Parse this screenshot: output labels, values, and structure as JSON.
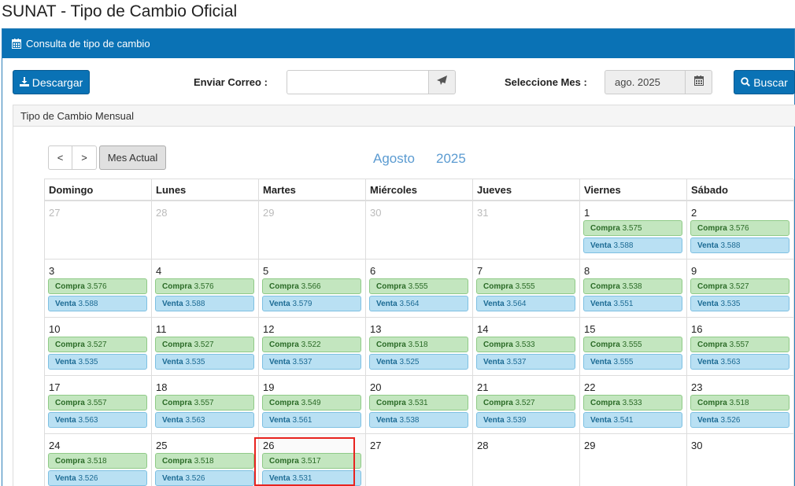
{
  "page": {
    "title": "SUNAT - Tipo de Cambio Oficial"
  },
  "panel": {
    "title": "Consulta de tipo de cambio",
    "icon": "calendar-icon"
  },
  "toolbar": {
    "download_label": "Descargar",
    "email_label": "Enviar Correo :",
    "email_value": "",
    "month_label": "Seleccione Mes :",
    "month_value": "ago. 2025",
    "search_label": "Buscar"
  },
  "calendar": {
    "section_title": "Tipo de Cambio Mensual",
    "prev_label": "<",
    "next_label": ">",
    "current_label": "Mes Actual",
    "month": "Agosto",
    "year": "2025",
    "weekdays": [
      "Domingo",
      "Lunes",
      "Martes",
      "Miércoles",
      "Jueves",
      "Viernes",
      "Sábado"
    ],
    "buy_prefix": "Compra",
    "sell_prefix": "Venta",
    "weeks": [
      [
        {
          "day": "27",
          "other": true
        },
        {
          "day": "28",
          "other": true
        },
        {
          "day": "29",
          "other": true
        },
        {
          "day": "30",
          "other": true
        },
        {
          "day": "31",
          "other": true
        },
        {
          "day": "1",
          "buy": "3.575",
          "sell": "3.588"
        },
        {
          "day": "2",
          "buy": "3.576",
          "sell": "3.588"
        }
      ],
      [
        {
          "day": "3",
          "buy": "3.576",
          "sell": "3.588"
        },
        {
          "day": "4",
          "buy": "3.576",
          "sell": "3.588"
        },
        {
          "day": "5",
          "buy": "3.566",
          "sell": "3.579"
        },
        {
          "day": "6",
          "buy": "3.555",
          "sell": "3.564"
        },
        {
          "day": "7",
          "buy": "3.555",
          "sell": "3.564"
        },
        {
          "day": "8",
          "buy": "3.538",
          "sell": "3.551"
        },
        {
          "day": "9",
          "buy": "3.527",
          "sell": "3.535"
        }
      ],
      [
        {
          "day": "10",
          "buy": "3.527",
          "sell": "3.535"
        },
        {
          "day": "11",
          "buy": "3.527",
          "sell": "3.535"
        },
        {
          "day": "12",
          "buy": "3.522",
          "sell": "3.537"
        },
        {
          "day": "13",
          "buy": "3.518",
          "sell": "3.525"
        },
        {
          "day": "14",
          "buy": "3.533",
          "sell": "3.537"
        },
        {
          "day": "15",
          "buy": "3.555",
          "sell": "3.555"
        },
        {
          "day": "16",
          "buy": "3.557",
          "sell": "3.563"
        }
      ],
      [
        {
          "day": "17",
          "buy": "3.557",
          "sell": "3.563"
        },
        {
          "day": "18",
          "buy": "3.557",
          "sell": "3.563"
        },
        {
          "day": "19",
          "buy": "3.549",
          "sell": "3.561"
        },
        {
          "day": "20",
          "buy": "3.531",
          "sell": "3.538"
        },
        {
          "day": "21",
          "buy": "3.527",
          "sell": "3.539"
        },
        {
          "day": "22",
          "buy": "3.533",
          "sell": "3.541"
        },
        {
          "day": "23",
          "buy": "3.518",
          "sell": "3.526"
        }
      ],
      [
        {
          "day": "24",
          "buy": "3.518",
          "sell": "3.526"
        },
        {
          "day": "25",
          "buy": "3.518",
          "sell": "3.526"
        },
        {
          "day": "26",
          "buy": "3.517",
          "sell": "3.531",
          "today": true
        },
        {
          "day": "27"
        },
        {
          "day": "28"
        },
        {
          "day": "29"
        },
        {
          "day": "30"
        }
      ]
    ]
  }
}
